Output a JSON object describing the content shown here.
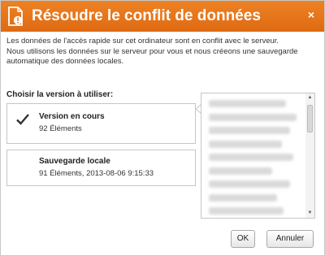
{
  "dialog": {
    "title": "Résoudre le conflit de données",
    "close_label": "×",
    "title_icon": "warning-document-icon",
    "accent_color": "#e8751b",
    "description_lines": [
      "Les données de l'accès rapide sur cet ordinateur sont en conflit avec le serveur.",
      "Nous utilisons les données sur le serveur pour vous et nous créeons une sauvegarde",
      "automatique des données locales."
    ],
    "choose_label": "Choisir la version à utiliser:",
    "options": [
      {
        "title": "Version en cours",
        "subtitle": "92 Éléments",
        "selected": true
      },
      {
        "title": "Sauvegarde locale",
        "subtitle": "91 Éléments, 2013-08-06 9:15:33",
        "selected": false
      }
    ],
    "buttons": {
      "ok": "OK",
      "cancel": "Annuler"
    }
  }
}
